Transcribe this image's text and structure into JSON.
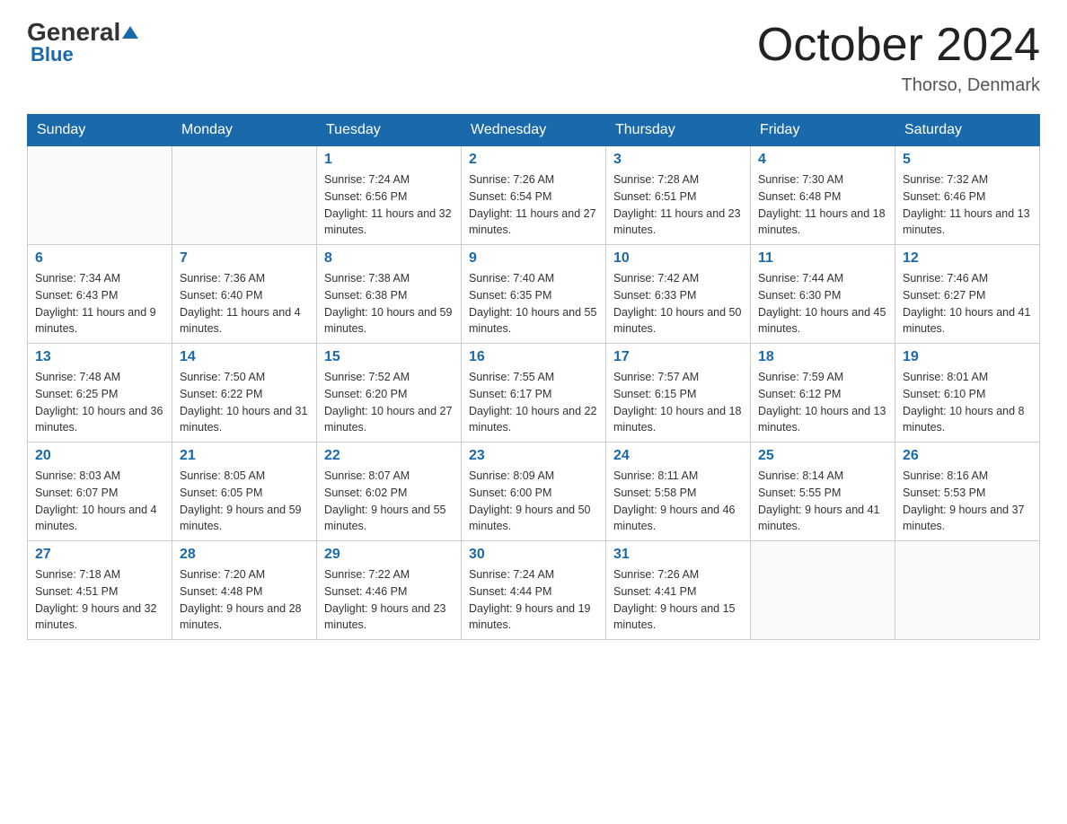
{
  "header": {
    "logo_general": "General",
    "logo_blue": "Blue",
    "month_title": "October 2024",
    "location": "Thorso, Denmark"
  },
  "days_of_week": [
    "Sunday",
    "Monday",
    "Tuesday",
    "Wednesday",
    "Thursday",
    "Friday",
    "Saturday"
  ],
  "weeks": [
    [
      {
        "day": "",
        "sunrise": "",
        "sunset": "",
        "daylight": ""
      },
      {
        "day": "",
        "sunrise": "",
        "sunset": "",
        "daylight": ""
      },
      {
        "day": "1",
        "sunrise": "Sunrise: 7:24 AM",
        "sunset": "Sunset: 6:56 PM",
        "daylight": "Daylight: 11 hours and 32 minutes."
      },
      {
        "day": "2",
        "sunrise": "Sunrise: 7:26 AM",
        "sunset": "Sunset: 6:54 PM",
        "daylight": "Daylight: 11 hours and 27 minutes."
      },
      {
        "day": "3",
        "sunrise": "Sunrise: 7:28 AM",
        "sunset": "Sunset: 6:51 PM",
        "daylight": "Daylight: 11 hours and 23 minutes."
      },
      {
        "day": "4",
        "sunrise": "Sunrise: 7:30 AM",
        "sunset": "Sunset: 6:48 PM",
        "daylight": "Daylight: 11 hours and 18 minutes."
      },
      {
        "day": "5",
        "sunrise": "Sunrise: 7:32 AM",
        "sunset": "Sunset: 6:46 PM",
        "daylight": "Daylight: 11 hours and 13 minutes."
      }
    ],
    [
      {
        "day": "6",
        "sunrise": "Sunrise: 7:34 AM",
        "sunset": "Sunset: 6:43 PM",
        "daylight": "Daylight: 11 hours and 9 minutes."
      },
      {
        "day": "7",
        "sunrise": "Sunrise: 7:36 AM",
        "sunset": "Sunset: 6:40 PM",
        "daylight": "Daylight: 11 hours and 4 minutes."
      },
      {
        "day": "8",
        "sunrise": "Sunrise: 7:38 AM",
        "sunset": "Sunset: 6:38 PM",
        "daylight": "Daylight: 10 hours and 59 minutes."
      },
      {
        "day": "9",
        "sunrise": "Sunrise: 7:40 AM",
        "sunset": "Sunset: 6:35 PM",
        "daylight": "Daylight: 10 hours and 55 minutes."
      },
      {
        "day": "10",
        "sunrise": "Sunrise: 7:42 AM",
        "sunset": "Sunset: 6:33 PM",
        "daylight": "Daylight: 10 hours and 50 minutes."
      },
      {
        "day": "11",
        "sunrise": "Sunrise: 7:44 AM",
        "sunset": "Sunset: 6:30 PM",
        "daylight": "Daylight: 10 hours and 45 minutes."
      },
      {
        "day": "12",
        "sunrise": "Sunrise: 7:46 AM",
        "sunset": "Sunset: 6:27 PM",
        "daylight": "Daylight: 10 hours and 41 minutes."
      }
    ],
    [
      {
        "day": "13",
        "sunrise": "Sunrise: 7:48 AM",
        "sunset": "Sunset: 6:25 PM",
        "daylight": "Daylight: 10 hours and 36 minutes."
      },
      {
        "day": "14",
        "sunrise": "Sunrise: 7:50 AM",
        "sunset": "Sunset: 6:22 PM",
        "daylight": "Daylight: 10 hours and 31 minutes."
      },
      {
        "day": "15",
        "sunrise": "Sunrise: 7:52 AM",
        "sunset": "Sunset: 6:20 PM",
        "daylight": "Daylight: 10 hours and 27 minutes."
      },
      {
        "day": "16",
        "sunrise": "Sunrise: 7:55 AM",
        "sunset": "Sunset: 6:17 PM",
        "daylight": "Daylight: 10 hours and 22 minutes."
      },
      {
        "day": "17",
        "sunrise": "Sunrise: 7:57 AM",
        "sunset": "Sunset: 6:15 PM",
        "daylight": "Daylight: 10 hours and 18 minutes."
      },
      {
        "day": "18",
        "sunrise": "Sunrise: 7:59 AM",
        "sunset": "Sunset: 6:12 PM",
        "daylight": "Daylight: 10 hours and 13 minutes."
      },
      {
        "day": "19",
        "sunrise": "Sunrise: 8:01 AM",
        "sunset": "Sunset: 6:10 PM",
        "daylight": "Daylight: 10 hours and 8 minutes."
      }
    ],
    [
      {
        "day": "20",
        "sunrise": "Sunrise: 8:03 AM",
        "sunset": "Sunset: 6:07 PM",
        "daylight": "Daylight: 10 hours and 4 minutes."
      },
      {
        "day": "21",
        "sunrise": "Sunrise: 8:05 AM",
        "sunset": "Sunset: 6:05 PM",
        "daylight": "Daylight: 9 hours and 59 minutes."
      },
      {
        "day": "22",
        "sunrise": "Sunrise: 8:07 AM",
        "sunset": "Sunset: 6:02 PM",
        "daylight": "Daylight: 9 hours and 55 minutes."
      },
      {
        "day": "23",
        "sunrise": "Sunrise: 8:09 AM",
        "sunset": "Sunset: 6:00 PM",
        "daylight": "Daylight: 9 hours and 50 minutes."
      },
      {
        "day": "24",
        "sunrise": "Sunrise: 8:11 AM",
        "sunset": "Sunset: 5:58 PM",
        "daylight": "Daylight: 9 hours and 46 minutes."
      },
      {
        "day": "25",
        "sunrise": "Sunrise: 8:14 AM",
        "sunset": "Sunset: 5:55 PM",
        "daylight": "Daylight: 9 hours and 41 minutes."
      },
      {
        "day": "26",
        "sunrise": "Sunrise: 8:16 AM",
        "sunset": "Sunset: 5:53 PM",
        "daylight": "Daylight: 9 hours and 37 minutes."
      }
    ],
    [
      {
        "day": "27",
        "sunrise": "Sunrise: 7:18 AM",
        "sunset": "Sunset: 4:51 PM",
        "daylight": "Daylight: 9 hours and 32 minutes."
      },
      {
        "day": "28",
        "sunrise": "Sunrise: 7:20 AM",
        "sunset": "Sunset: 4:48 PM",
        "daylight": "Daylight: 9 hours and 28 minutes."
      },
      {
        "day": "29",
        "sunrise": "Sunrise: 7:22 AM",
        "sunset": "Sunset: 4:46 PM",
        "daylight": "Daylight: 9 hours and 23 minutes."
      },
      {
        "day": "30",
        "sunrise": "Sunrise: 7:24 AM",
        "sunset": "Sunset: 4:44 PM",
        "daylight": "Daylight: 9 hours and 19 minutes."
      },
      {
        "day": "31",
        "sunrise": "Sunrise: 7:26 AM",
        "sunset": "Sunset: 4:41 PM",
        "daylight": "Daylight: 9 hours and 15 minutes."
      },
      {
        "day": "",
        "sunrise": "",
        "sunset": "",
        "daylight": ""
      },
      {
        "day": "",
        "sunrise": "",
        "sunset": "",
        "daylight": ""
      }
    ]
  ]
}
